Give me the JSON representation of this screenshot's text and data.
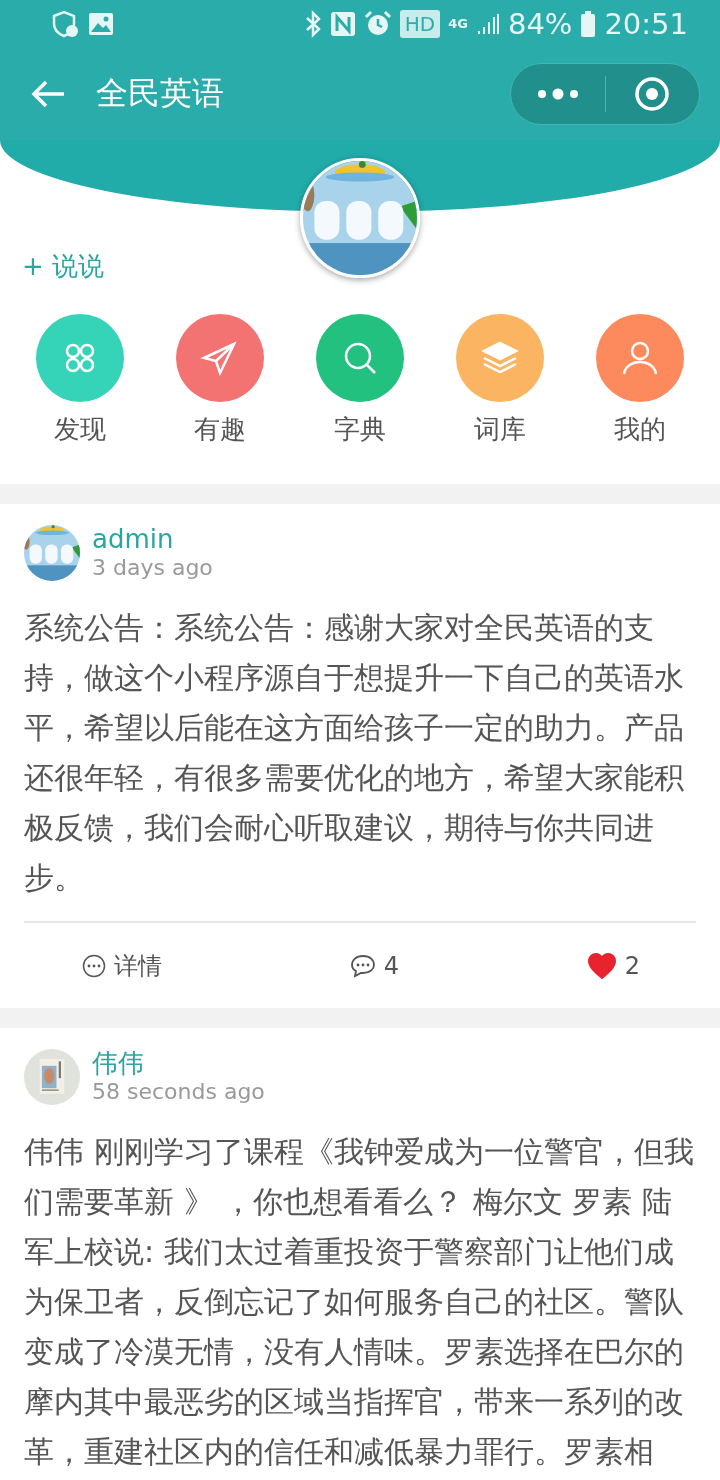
{
  "status_bar": {
    "badge": "HD",
    "network": "4G",
    "battery": "84%",
    "time": "20:51"
  },
  "header": {
    "title": "全民英语"
  },
  "profile": {
    "compose": "+ 说说"
  },
  "nav": [
    {
      "label": "发现",
      "color": "#35d3b8",
      "kind": "grid"
    },
    {
      "label": "有趣",
      "color": "#f37373",
      "kind": "plane"
    },
    {
      "label": "字典",
      "color": "#22c17f",
      "kind": "search"
    },
    {
      "label": "词库",
      "color": "#fbb461",
      "kind": "layers"
    },
    {
      "label": "我的",
      "color": "#fc8a5c",
      "kind": "user"
    }
  ],
  "posts": [
    {
      "author": "admin",
      "time": "3 days ago",
      "text": "系统公告：系统公告：感谢大家对全民英语的支持，做这个小程序源自于想提升一下自己的英语水平，希望以后能在这方面给孩子一定的助力。产品还很年轻，有很多需要优化的地方，希望大家能积极反馈，我们会耐心听取建议，期待与你共同进步。",
      "actions": {
        "detail": "详情",
        "comments": "4",
        "likes": "2",
        "liked": true
      }
    },
    {
      "author": "伟伟",
      "time": "58 seconds ago",
      "text": "伟伟 刚刚学习了课程《我钟爱成为一位警官，但我们需要革新 》 ，你也想看看么？ 梅尔文 罗素 陆军上校说: 我们太过着重投资于警察部门让他们成为保卫者，反倒忘记了如何服务自己的社区。警队变成了冷漠无情，没有人情味。罗素选择在巴尔的摩内其中最恶劣的区域当指挥官，带来一系列的改革，重建社区内的信任和减低暴力罪行。罗素相"
    }
  ]
}
